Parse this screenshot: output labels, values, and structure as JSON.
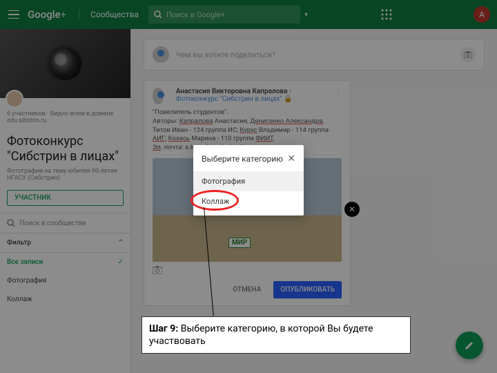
{
  "header": {
    "logo": "Google",
    "logo_plus": "+",
    "nav_label": "Сообщества",
    "search_placeholder": "Поиск в Google+",
    "avatar_letter": "A"
  },
  "sidebar": {
    "meta": "6 участников · Видно всем в домене edu.sibstrin.ru",
    "title": "Фотоконкурс \"Сибстрин в лицах\"",
    "desc": "Фотографии на тему юбилея 90-летия НГАСУ (Сибстрин)",
    "member_btn": "УЧАСТНИК",
    "search_placeholder": "Поиск в сообществе",
    "filter_label": "Фильтр",
    "filters": {
      "all": "Все записи",
      "photo": "Фотография",
      "collage": "Коллаж"
    }
  },
  "main": {
    "share_prompt": "Чем вы хотите поделиться?",
    "post": {
      "author": "Анастасия Викторовна Капралова",
      "separator": "›",
      "group": "Фотоконкурс \"Сибстрин в лицах\"",
      "body_title": "\"Повелитель студентов\".",
      "body_line1_a": "Авторы: ",
      "body_line1_b": "Капралова",
      "body_line1_c": " Анастасия, ",
      "body_line1_d": "Денисенко Александра",
      "body_line1_e": ", Титов Иван - 124 группа ИС; ",
      "body_line1_f": "Курус",
      "body_line1_g": " Владимир - 114 группа ",
      "body_line1_h": "АИГ",
      "body_line1_i": "; ",
      "body_line1_j": "Кохась",
      "body_line1_k": " Марина - 110 группа ",
      "body_line1_l": "ФИИТ",
      "body_line1_m": ".",
      "body_line2_a": "Эл",
      "body_line2_b": ". почта: a.kapralova@edu.sibstrin.ru",
      "cancel": "ОТМЕНА",
      "publish": "ОПУБЛИКОВАТЬ"
    },
    "category_dialog": {
      "title": "Выберите категорию",
      "options": {
        "photo": "Фотография",
        "collage": "Коллаж"
      }
    },
    "instruction_bold": "Шаг 9: ",
    "instruction_text": "Выберите категорию, в которой Вы будете участвовать"
  }
}
